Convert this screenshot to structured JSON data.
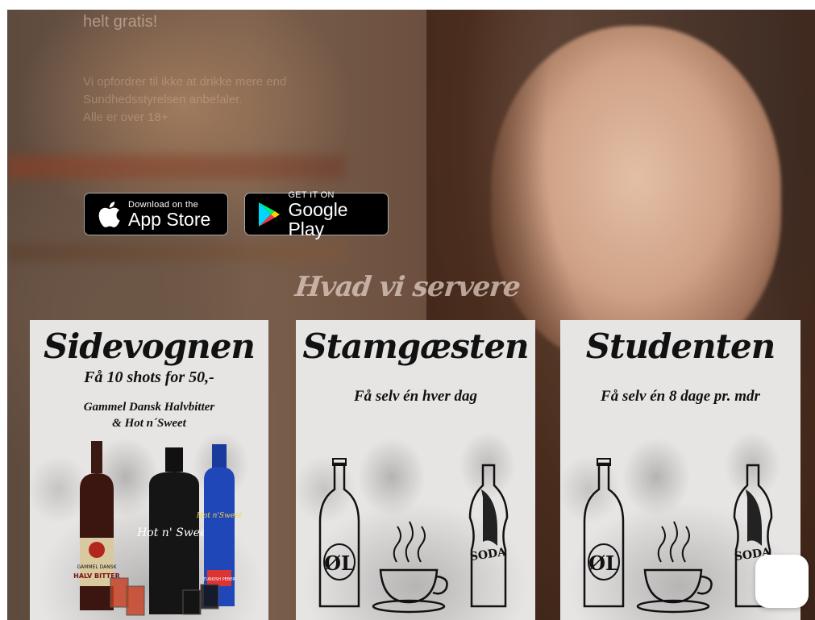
{
  "intro": {
    "line1": "helt gratis!",
    "para1": "Vi opfordrer til ikke at drikke mere end",
    "para2": "Sundhedsstyrelsen anbefaler.",
    "para3": "Alle er over 18+"
  },
  "store_buttons": {
    "apple": {
      "small": "Download on the",
      "big": "App Store"
    },
    "google": {
      "small": "GET IT ON",
      "big": "Google Play"
    }
  },
  "section_title": "Hvad vi servere",
  "cards": [
    {
      "title": "Sidevognen",
      "line1": "Få 10 shots for 50,-",
      "line2a": "Gammel Dansk Halvbitter",
      "line2b": "& Hot n´Sweet",
      "bottle_labels": [
        "GAMMEL DANSK",
        "HALV BITTER",
        "Hot n' Sweet",
        "Hot n'Sweet",
        "TURKISH PEBER"
      ]
    },
    {
      "title": "Stamgæsten",
      "offer": "Få selv én hver dag",
      "bottle_labels": [
        "ØL",
        "SODA"
      ]
    },
    {
      "title": "Studenten",
      "offer": "Få selv én 8 dage pr. mdr",
      "bottle_labels": [
        "ØL",
        "SODA"
      ]
    }
  ],
  "colors": {
    "card_bg": "#e7e5e4",
    "button_bg": "#000000"
  }
}
